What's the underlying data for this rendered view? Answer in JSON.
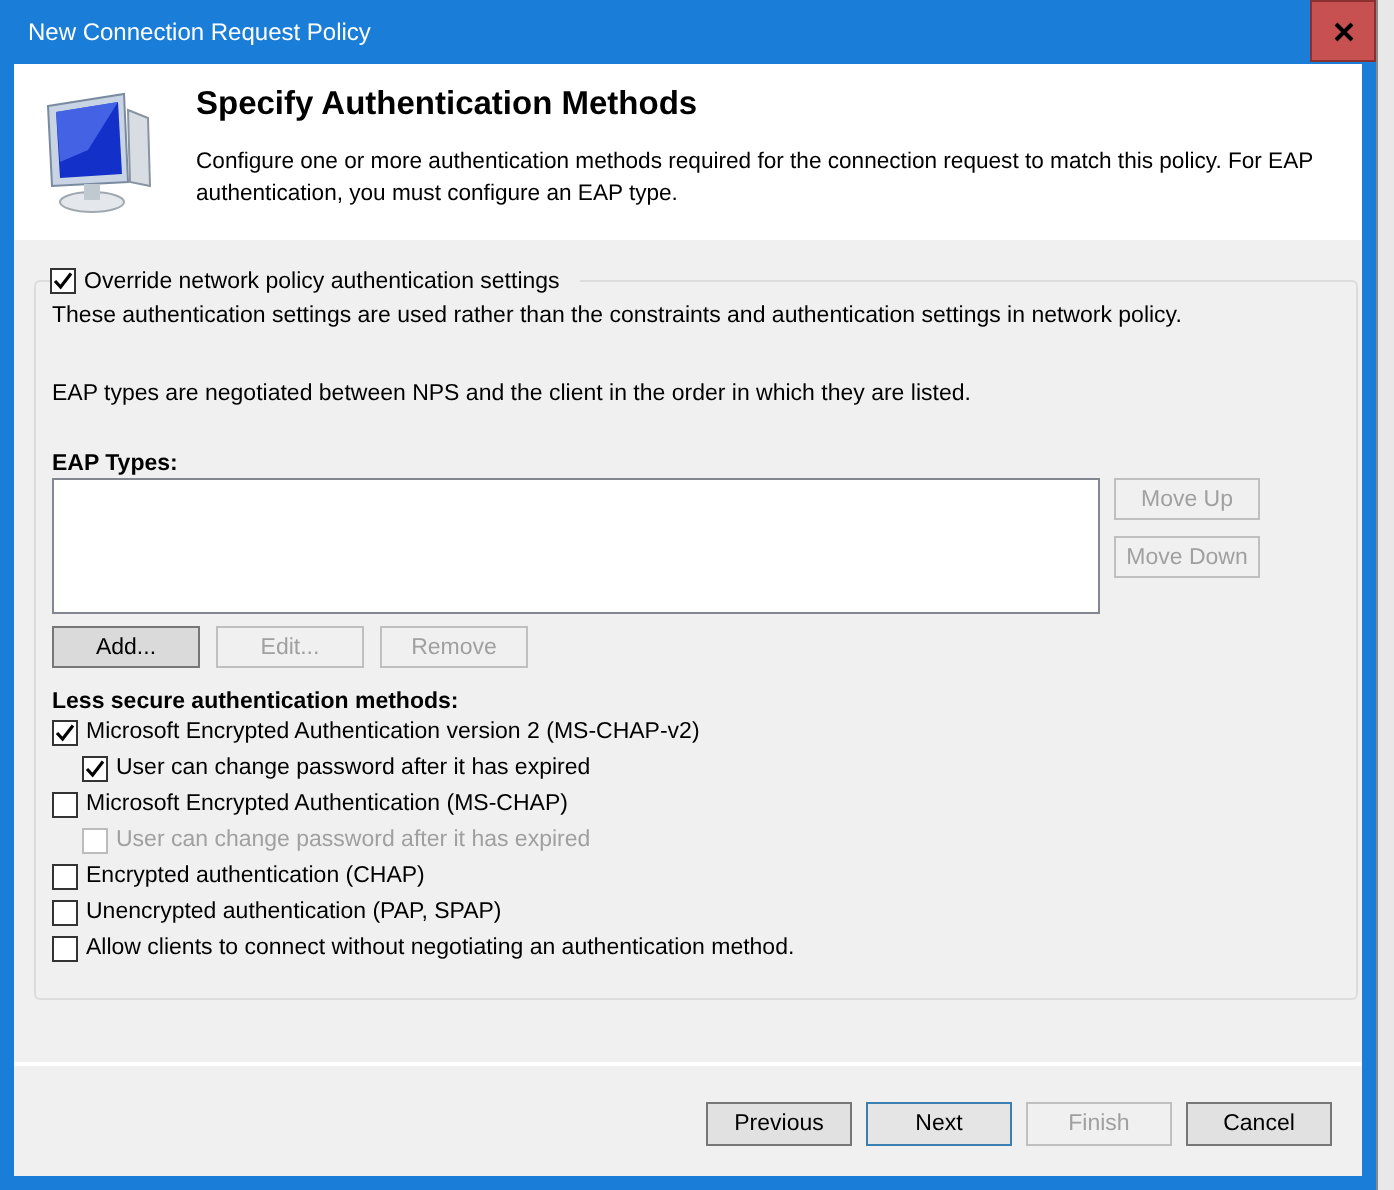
{
  "window": {
    "title": "New Connection Request Policy"
  },
  "header": {
    "title": "Specify Authentication Methods",
    "description": "Configure one or more authentication methods required for the connection request to match this policy. For EAP authentication, you must configure an EAP type."
  },
  "group": {
    "override": {
      "label": "Override network policy authentication settings",
      "checked": true
    },
    "note": "These authentication settings are used rather than the constraints and authentication settings in network policy.",
    "eap_note": "EAP types are negotiated between NPS and the client in the order in which they are listed.",
    "eap_label": "EAP Types:",
    "side_buttons": [
      {
        "label": "Move Up",
        "disabled": true
      },
      {
        "label": "Move Down",
        "disabled": true
      }
    ],
    "list_buttons": [
      {
        "label": "Add...",
        "disabled": false
      },
      {
        "label": "Edit...",
        "disabled": true
      },
      {
        "label": "Remove",
        "disabled": true
      }
    ],
    "less_secure": {
      "heading": "Less secure authentication methods:",
      "options": [
        {
          "label": "Microsoft Encrypted Authentication version 2 (MS-CHAP-v2)",
          "checked": true,
          "disabled": false,
          "children": [
            {
              "label": "User can change password after it has expired",
              "checked": true,
              "disabled": false
            }
          ]
        },
        {
          "label": "Microsoft Encrypted Authentication (MS-CHAP)",
          "checked": false,
          "disabled": false,
          "children": [
            {
              "label": "User can change password after it has expired",
              "checked": false,
              "disabled": true
            }
          ]
        },
        {
          "label": "Encrypted authentication (CHAP)",
          "checked": false,
          "disabled": false
        },
        {
          "label": "Unencrypted authentication (PAP, SPAP)",
          "checked": false,
          "disabled": false
        },
        {
          "label": "Allow clients to connect without negotiating an authentication method.",
          "checked": false,
          "disabled": false
        }
      ]
    }
  },
  "footer_buttons": [
    {
      "label": "Previous",
      "disabled": false,
      "focused": false
    },
    {
      "label": "Next",
      "disabled": false,
      "focused": true
    },
    {
      "label": "Finish",
      "disabled": true,
      "focused": false
    },
    {
      "label": "Cancel",
      "disabled": false,
      "focused": false
    }
  ]
}
